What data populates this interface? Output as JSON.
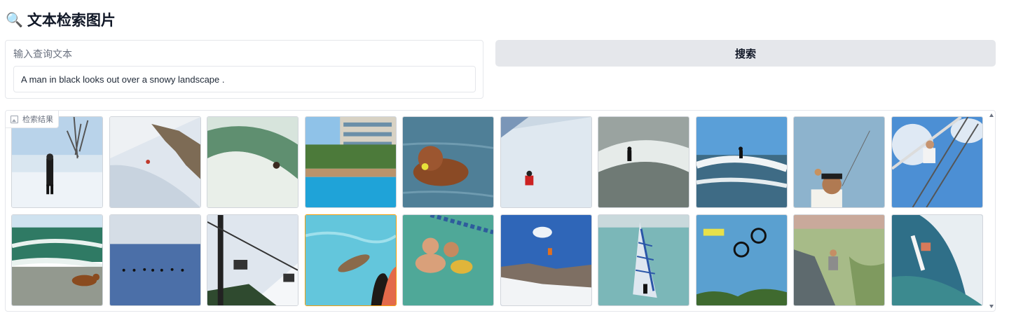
{
  "header": {
    "icon": "magnifier-emoji",
    "emoji": "🔍",
    "title": "文本检索图片"
  },
  "query": {
    "label": "输入查询文本",
    "value": "A man in black looks out over a snowy landscape ."
  },
  "search_button": {
    "label": "搜索"
  },
  "gallery": {
    "label": "检索结果",
    "icon": "image-icon",
    "selected_index": 13,
    "images": [
      {
        "subject": "man in black on snowy lakeshore"
      },
      {
        "subject": "skier on steep snowy slope"
      },
      {
        "subject": "surfer in wave barrel"
      },
      {
        "subject": "hotel swimming pool"
      },
      {
        "subject": "dog swimming with ball"
      },
      {
        "subject": "person in red on snow slope"
      },
      {
        "subject": "surfer on grey wave"
      },
      {
        "subject": "surfer on blue wave"
      },
      {
        "subject": "boy with kite"
      },
      {
        "subject": "man on zipline"
      },
      {
        "subject": "dog on beach shore"
      },
      {
        "subject": "surfers in open sea"
      },
      {
        "subject": "ski lift chairs"
      },
      {
        "subject": "dogs in pool"
      },
      {
        "subject": "people in swimming pool"
      },
      {
        "subject": "snowboarder jumping"
      },
      {
        "subject": "windsurfer"
      },
      {
        "subject": "bmx rider mid-air"
      },
      {
        "subject": "hiker on rocky cliff"
      },
      {
        "subject": "surfer in spray"
      }
    ]
  },
  "colors": {
    "button_bg": "#e5e7eb",
    "border": "#e5e7eb",
    "selected_border": "#f59e0b"
  }
}
